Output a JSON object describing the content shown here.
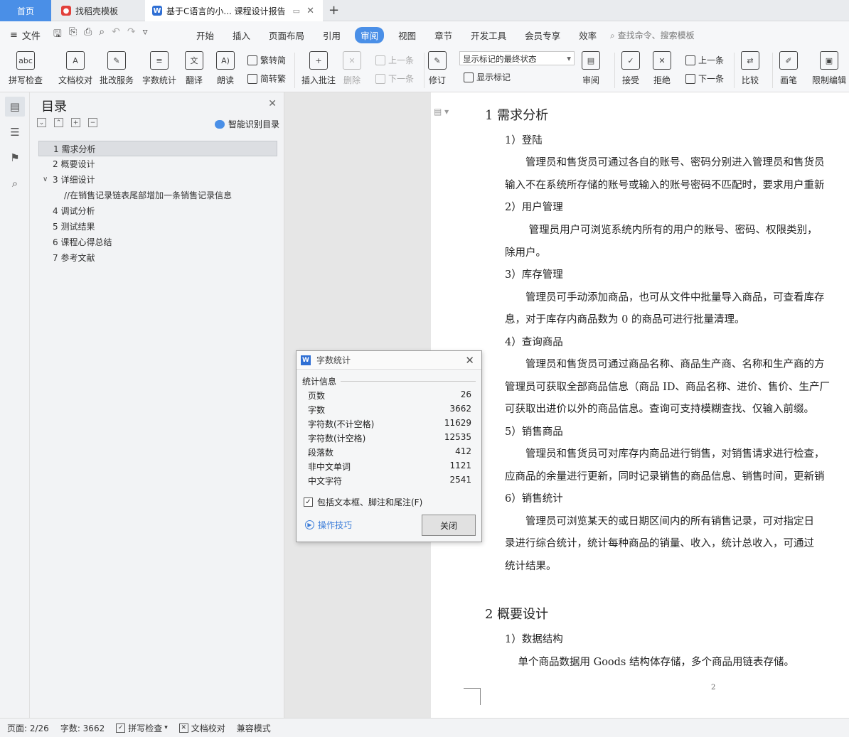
{
  "tabs": [
    {
      "label": "首页"
    },
    {
      "label": "找稻壳模板"
    },
    {
      "label": "基于C语言的小... 课程设计报告"
    }
  ],
  "menu": {
    "file": "文件",
    "items": [
      "开始",
      "插入",
      "页面布局",
      "引用",
      "审阅",
      "视图",
      "章节",
      "开发工具",
      "会员专享",
      "效率"
    ],
    "active": "审阅",
    "search": "查找命令、搜索模板"
  },
  "ribbon": {
    "spell": "拼写检查",
    "doc_check": "文档校对",
    "batch": "批改服务",
    "word_count": "字数统计",
    "translate": "翻译",
    "read": "朗读",
    "trad_to_simp": "繁转简",
    "simp_to_trad": "简转繁",
    "insert_comment": "插入批注",
    "delete": "删除",
    "prev": "上一条",
    "next": "下一条",
    "revise": "修订",
    "markup_select": "显示标记的最终状态",
    "show_markup": "显示标记",
    "review": "审阅",
    "accept": "接受",
    "reject": "拒绝",
    "prev2": "上一条",
    "next2": "下一条",
    "compare": "比较",
    "pen": "画笔",
    "restrict": "限制编辑"
  },
  "toc": {
    "title": "目录",
    "smart": "智能识别目录",
    "items": [
      "1 需求分析",
      "2 概要设计",
      "3 详细设计",
      "//在销售记录链表尾部增加一条销售记录信息",
      "4 调试分析",
      "5 测试结果",
      "6 课程心得总结",
      "7 参考文献"
    ]
  },
  "doc": {
    "h1_1": "1  需求分析",
    "s1": "1）登陆",
    "p1a": "　　管理员和售货员可通过各自的账号、密码分别进入管理员和售货员",
    "p1b": "输入不在系统所存储的账号或输入的账号密码不匹配时，要求用户重新",
    "s2": "2）用户管理",
    "p2a": "　　 管理员用户可浏览系统内所有的用户的账号、密码、权限类别，",
    "p2b": " 除用户。",
    "s3": "3）库存管理",
    "p3a": "　　管理员可手动添加商品，也可从文件中批量导入商品，可查看库存",
    "p3b": "息，对于库存内商品数为 0 的商品可进行批量清理。",
    "s4": "4）查询商品",
    "p4a": "　　管理员和售货员可通过商品名称、商品生产商、名称和生产商的方",
    "p4b": "管理员可获取全部商品信息（商品 ID、商品名称、进价、售价、生产厂",
    "p4c": "可获取出进价以外的商品信息。查询可支持模糊查找、仅输入前缀。",
    "s5": "5）销售商品",
    "p5a": "　　管理员和售货员可对库存内商品进行销售，对销售请求进行检查，",
    "p5b": "应商品的余量进行更新，同时记录销售的商品信息、销售时间，更新销",
    "s6": "6）销售统计",
    "p6a": "　　管理员可浏览某天的或日期区间内的所有销售记录，可对指定日",
    "p6b": "录进行综合统计，统计每种商品的销量、收入，统计总收入，可通过",
    "p6c": "统计结果。",
    "h1_2": "2  概要设计",
    "s7": "1）数据结构",
    "p7a": "　单个商品数据用 Goods 结构体存储，多个商品用链表存储。",
    "page_number": "2"
  },
  "dialog": {
    "title": "字数统计",
    "section": "统计信息",
    "stats": [
      {
        "label": "页数",
        "value": "26"
      },
      {
        "label": "字数",
        "value": "3662"
      },
      {
        "label": "字符数(不计空格)",
        "value": "11629"
      },
      {
        "label": "字符数(计空格)",
        "value": "12535"
      },
      {
        "label": "段落数",
        "value": "412"
      },
      {
        "label": "非中文单词",
        "value": "1121"
      },
      {
        "label": "中文字符",
        "value": "2541"
      }
    ],
    "checkbox": "包括文本框、脚注和尾注(F)",
    "tips": "操作技巧",
    "close": "关闭"
  },
  "status": {
    "page": "页面: 2/26",
    "words": "字数: 3662",
    "spell": "拼写检查",
    "doc_check": "文档校对",
    "compat": "兼容模式"
  },
  "colors": {
    "accent": "#4a8fe7",
    "link": "#3c7dd9"
  }
}
